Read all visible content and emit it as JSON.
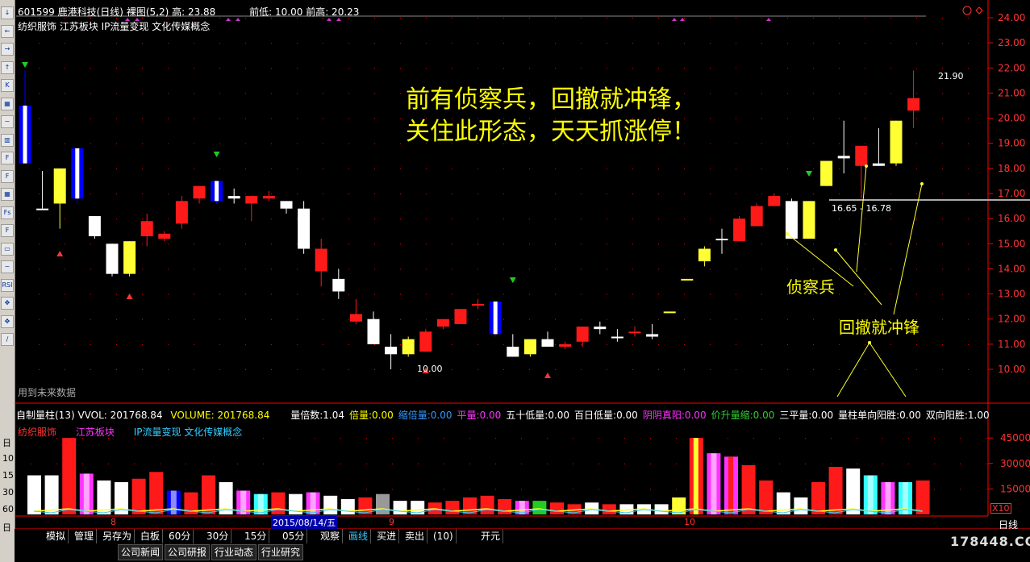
{
  "header": {
    "code_name": "601599 鹿港科技(日线)",
    "mode": "裸图(5,2)",
    "high_label": "高: 23.88",
    "prev_low": "前低: 10.00",
    "prev_high": "前高: 20.23"
  },
  "concepts": "纺织服饰 江苏板块 IP流量变现 文化传媒概念",
  "future_note": "用到未来数据",
  "price_axis": [
    "24.00",
    "23.00",
    "22.00",
    "21.00",
    "20.00",
    "19.00",
    "18.00",
    "17.00",
    "16.00",
    "15.00",
    "14.00",
    "13.00",
    "12.00",
    "11.00",
    "10.00"
  ],
  "price_labels": {
    "top": "21.90",
    "bottom": "10.00",
    "range": "16.65 - 16.78"
  },
  "annotations": {
    "headline_1": "前有侦察兵，回撤就冲锋，",
    "headline_2": "关住此形态，天天抓涨停！",
    "scout": "侦察兵",
    "charge": "回撤就冲锋"
  },
  "volume_header": {
    "title": "自制量柱(13)",
    "vvol": "VVOL: 201768.84",
    "volume": "VOLUME: 201768.84",
    "metrics": [
      {
        "label": "量倍数:",
        "value": "1.04",
        "color": "#ffffff"
      },
      {
        "label": "倍量:",
        "value": "0.00",
        "color": "#ffff00"
      },
      {
        "label": "缩倍量:",
        "value": "0.00",
        "color": "#3399ff"
      },
      {
        "label": "平量:",
        "value": "0.00",
        "color": "#ff33ff"
      },
      {
        "label": "五十低量:",
        "value": "0.00",
        "color": "#ffffff"
      },
      {
        "label": "百日低量:",
        "value": "0.00",
        "color": "#ffffff"
      },
      {
        "label": "阴阴真阳:",
        "value": "0.00",
        "color": "#ff33ff"
      },
      {
        "label": "价升量缩:",
        "value": "0.00",
        "color": "#33cc33"
      },
      {
        "label": "三平量:",
        "value": "0.00",
        "color": "#ffffff"
      },
      {
        "label": "量柱单向阳胜:",
        "value": "0.00",
        "color": "#ffffff"
      },
      {
        "label": "双向阳胜:",
        "value": "1.00",
        "color": "#ffffff"
      }
    ],
    "tags": [
      "纺织服饰",
      "江苏板块",
      "IP流量变现 文化传媒概念"
    ]
  },
  "volume_axis": [
    "45000",
    "30000",
    "15000"
  ],
  "volume_unit": "X10",
  "date_axis": {
    "m8": "8",
    "date": "2015/08/14/五",
    "m9": "9",
    "m10": "10"
  },
  "period": "日线",
  "tabs_row1": [
    "模拟",
    "管理",
    "另存为",
    "白板",
    "60分",
    "30分",
    "15分",
    "05分",
    "观察",
    "画线",
    "买进",
    "卖出",
    "(10)",
    "开元"
  ],
  "tabs_row2": [
    "公司新闻",
    "公司研报",
    "行业动态",
    "行业研究"
  ],
  "left_toolbar": [
    "↓",
    "←",
    "→",
    "↑",
    "K",
    "▦",
    "~",
    "▥",
    "F",
    "F",
    "▦",
    "Fs",
    "F",
    "▭",
    "~",
    "RSI",
    "✥",
    "✥",
    "∕"
  ],
  "left_numbers": [
    "日",
    "10",
    "15",
    "30",
    "60",
    "日"
  ],
  "watermark": "178448.COM",
  "colors": {
    "up": "#ff0000",
    "down": "#ffffff",
    "yellow": "#ffff00",
    "blue": "#0000ff",
    "axis": "#ff0000",
    "annotation": "#ffff00"
  },
  "chart_data": {
    "type": "candlestick",
    "ylim": [
      10,
      24
    ],
    "candles": [
      {
        "o": 20.5,
        "h": 21.9,
        "l": 18.2,
        "c": 18.2,
        "t": "blue"
      },
      {
        "o": 16.4,
        "h": 17.9,
        "l": 16.4,
        "c": 16.4,
        "t": "white"
      },
      {
        "o": 18.0,
        "h": 18.0,
        "l": 15.6,
        "c": 16.6,
        "t": "yellow"
      },
      {
        "o": 18.8,
        "h": 18.8,
        "l": 16.6,
        "c": 16.8,
        "t": "blue"
      },
      {
        "o": 16.1,
        "h": 16.1,
        "l": 15.2,
        "c": 15.3,
        "t": "white"
      },
      {
        "o": 15.0,
        "h": 15.0,
        "l": 13.7,
        "c": 13.8,
        "t": "white"
      },
      {
        "o": 15.1,
        "h": 15.1,
        "l": 13.7,
        "c": 13.8,
        "t": "yellow"
      },
      {
        "o": 15.3,
        "h": 16.2,
        "l": 14.9,
        "c": 15.9,
        "t": "red"
      },
      {
        "o": 15.2,
        "h": 15.5,
        "l": 15.1,
        "c": 15.4,
        "t": "red"
      },
      {
        "o": 15.8,
        "h": 16.9,
        "l": 15.6,
        "c": 16.7,
        "t": "red"
      },
      {
        "o": 16.8,
        "h": 17.3,
        "l": 16.6,
        "c": 17.3,
        "t": "red"
      },
      {
        "o": 17.5,
        "h": 17.5,
        "l": 16.6,
        "c": 16.7,
        "t": "blue"
      },
      {
        "o": 16.9,
        "h": 17.2,
        "l": 16.6,
        "c": 16.8,
        "t": "white"
      },
      {
        "o": 16.6,
        "h": 16.9,
        "l": 15.9,
        "c": 16.9,
        "t": "red"
      },
      {
        "o": 16.8,
        "h": 17.1,
        "l": 16.7,
        "c": 16.9,
        "t": "red"
      },
      {
        "o": 16.7,
        "h": 16.7,
        "l": 16.2,
        "c": 16.4,
        "t": "white"
      },
      {
        "o": 16.4,
        "h": 16.7,
        "l": 14.6,
        "c": 14.8,
        "t": "white"
      },
      {
        "o": 13.9,
        "h": 15.2,
        "l": 13.3,
        "c": 14.8,
        "t": "red"
      },
      {
        "o": 13.6,
        "h": 14.0,
        "l": 12.8,
        "c": 13.1,
        "t": "white"
      },
      {
        "o": 11.9,
        "h": 12.8,
        "l": 11.8,
        "c": 12.2,
        "t": "red"
      },
      {
        "o": 12.0,
        "h": 12.3,
        "l": 11.0,
        "c": 11.0,
        "t": "white"
      },
      {
        "o": 10.9,
        "h": 11.4,
        "l": 10.0,
        "c": 10.6,
        "t": "white"
      },
      {
        "o": 10.6,
        "h": 11.3,
        "l": 10.5,
        "c": 11.2,
        "t": "yellow"
      },
      {
        "o": 10.7,
        "h": 11.6,
        "l": 10.7,
        "c": 11.5,
        "t": "red"
      },
      {
        "o": 11.7,
        "h": 12.0,
        "l": 11.6,
        "c": 12.0,
        "t": "red"
      },
      {
        "o": 11.8,
        "h": 12.4,
        "l": 11.8,
        "c": 12.4,
        "t": "red"
      },
      {
        "o": 12.6,
        "h": 12.8,
        "l": 12.4,
        "c": 12.6,
        "t": "red"
      },
      {
        "o": 12.7,
        "h": 12.7,
        "l": 11.3,
        "c": 11.4,
        "t": "blue"
      },
      {
        "o": 10.9,
        "h": 11.4,
        "l": 10.5,
        "c": 10.5,
        "t": "white"
      },
      {
        "o": 10.6,
        "h": 11.2,
        "l": 10.5,
        "c": 11.2,
        "t": "yellow"
      },
      {
        "o": 11.2,
        "h": 11.5,
        "l": 10.9,
        "c": 10.9,
        "t": "white"
      },
      {
        "o": 10.9,
        "h": 11.1,
        "l": 10.8,
        "c": 11.0,
        "t": "red"
      },
      {
        "o": 11.1,
        "h": 11.7,
        "l": 10.9,
        "c": 11.7,
        "t": "red"
      },
      {
        "o": 11.7,
        "h": 11.9,
        "l": 11.4,
        "c": 11.6,
        "t": "white"
      },
      {
        "o": 11.3,
        "h": 11.6,
        "l": 11.1,
        "c": 11.3,
        "t": "white"
      },
      {
        "o": 11.5,
        "h": 11.7,
        "l": 11.3,
        "c": 11.5,
        "t": "red"
      },
      {
        "o": 11.4,
        "h": 11.8,
        "l": 11.2,
        "c": 11.3,
        "t": "white"
      },
      {
        "o": 12.3,
        "h": 12.3,
        "l": 12.3,
        "c": 12.3,
        "t": "yellow"
      },
      {
        "o": 13.6,
        "h": 13.6,
        "l": 13.6,
        "c": 13.6,
        "t": "yellow"
      },
      {
        "o": 14.3,
        "h": 14.9,
        "l": 14.1,
        "c": 14.8,
        "t": "yellow"
      },
      {
        "o": 15.2,
        "h": 15.6,
        "l": 14.6,
        "c": 15.2,
        "t": "white"
      },
      {
        "o": 15.1,
        "h": 16.1,
        "l": 15.1,
        "c": 16.0,
        "t": "red"
      },
      {
        "o": 15.7,
        "h": 16.6,
        "l": 15.7,
        "c": 16.5,
        "t": "red"
      },
      {
        "o": 16.5,
        "h": 17.0,
        "l": 16.5,
        "c": 16.9,
        "t": "red"
      },
      {
        "o": 16.7,
        "h": 16.8,
        "l": 15.2,
        "c": 15.2,
        "t": "white"
      },
      {
        "o": 16.7,
        "h": 16.7,
        "l": 15.2,
        "c": 15.2,
        "t": "yellow"
      },
      {
        "o": 17.3,
        "h": 18.3,
        "l": 17.3,
        "c": 18.3,
        "t": "yellow"
      },
      {
        "o": 18.4,
        "h": 19.9,
        "l": 17.8,
        "c": 18.5,
        "t": "white"
      },
      {
        "o": 18.1,
        "h": 18.9,
        "l": 16.8,
        "c": 18.9,
        "t": "red"
      },
      {
        "o": 18.1,
        "h": 19.6,
        "l": 18.1,
        "c": 18.2,
        "t": "white"
      },
      {
        "o": 18.2,
        "h": 19.9,
        "l": 18.1,
        "c": 19.9,
        "t": "yellow"
      },
      {
        "o": 20.3,
        "h": 21.9,
        "l": 19.6,
        "c": 20.8,
        "t": "red"
      }
    ],
    "volume": [
      {
        "v": 23000,
        "t": "white"
      },
      {
        "v": 23000,
        "t": "white"
      },
      {
        "v": 45000,
        "t": "red"
      },
      {
        "v": 24000,
        "t": "magenta"
      },
      {
        "v": 20000,
        "t": "white"
      },
      {
        "v": 19000,
        "t": "white"
      },
      {
        "v": 21000,
        "t": "red"
      },
      {
        "v": 25000,
        "t": "red"
      },
      {
        "v": 14000,
        "t": "blue"
      },
      {
        "v": 13000,
        "t": "red"
      },
      {
        "v": 23000,
        "t": "red"
      },
      {
        "v": 19000,
        "t": "white"
      },
      {
        "v": 14000,
        "t": "magenta"
      },
      {
        "v": 12000,
        "t": "cyan"
      },
      {
        "v": 13000,
        "t": "red"
      },
      {
        "v": 12000,
        "t": "white"
      },
      {
        "v": 13000,
        "t": "magenta"
      },
      {
        "v": 11000,
        "t": "white"
      },
      {
        "v": 9000,
        "t": "white"
      },
      {
        "v": 10000,
        "t": "red"
      },
      {
        "v": 12000,
        "t": "gray"
      },
      {
        "v": 8000,
        "t": "white"
      },
      {
        "v": 8000,
        "t": "white"
      },
      {
        "v": 7000,
        "t": "red"
      },
      {
        "v": 8000,
        "t": "red"
      },
      {
        "v": 10000,
        "t": "red"
      },
      {
        "v": 11000,
        "t": "red"
      },
      {
        "v": 9000,
        "t": "red"
      },
      {
        "v": 8000,
        "t": "magenta"
      },
      {
        "v": 8000,
        "t": "green"
      },
      {
        "v": 7000,
        "t": "red"
      },
      {
        "v": 6000,
        "t": "red"
      },
      {
        "v": 7000,
        "t": "white"
      },
      {
        "v": 6000,
        "t": "red"
      },
      {
        "v": 6000,
        "t": "white"
      },
      {
        "v": 6000,
        "t": "white"
      },
      {
        "v": 6000,
        "t": "white"
      },
      {
        "v": 10000,
        "t": "yellow"
      },
      {
        "v": 45000,
        "t": "yellowred"
      },
      {
        "v": 36000,
        "t": "magenta"
      },
      {
        "v": 34000,
        "t": "redmag"
      },
      {
        "v": 29000,
        "t": "red"
      },
      {
        "v": 20000,
        "t": "red"
      },
      {
        "v": 13000,
        "t": "white"
      },
      {
        "v": 10000,
        "t": "white"
      },
      {
        "v": 19000,
        "t": "red"
      },
      {
        "v": 28000,
        "t": "red"
      },
      {
        "v": 27000,
        "t": "white"
      },
      {
        "v": 23000,
        "t": "cyan"
      },
      {
        "v": 19000,
        "t": "magenta"
      },
      {
        "v": 19000,
        "t": "cyan"
      },
      {
        "v": 20000,
        "t": "red"
      }
    ]
  }
}
